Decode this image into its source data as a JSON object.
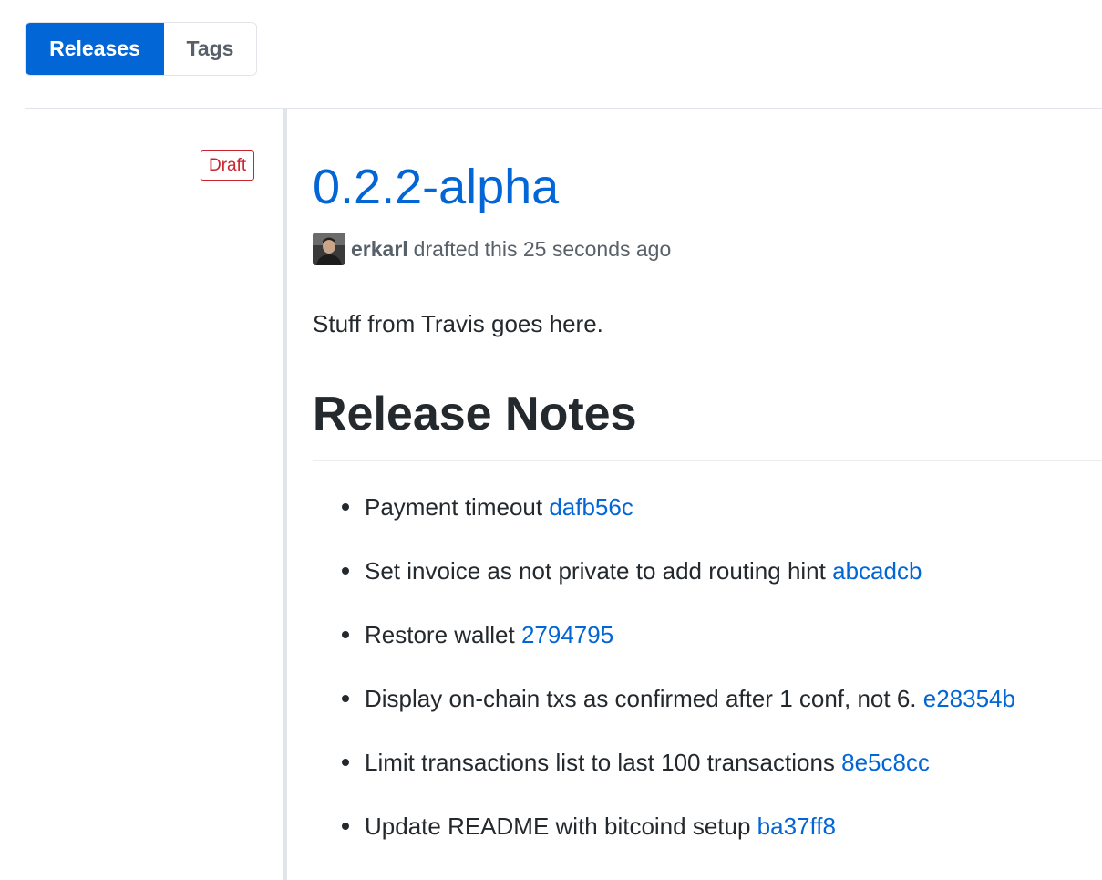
{
  "tabs": {
    "releases": "Releases",
    "tags": "Tags"
  },
  "release": {
    "status_label": "Draft",
    "title": "0.2.2-alpha",
    "author": "erkarl",
    "meta_text": "drafted this 25 seconds ago",
    "body": "Stuff from Travis goes here.",
    "notes_heading": "Release Notes",
    "notes": [
      {
        "text": "Payment timeout",
        "commit": "dafb56c"
      },
      {
        "text": "Set invoice as not private to add routing hint",
        "commit": "abcadcb"
      },
      {
        "text": "Restore wallet",
        "commit": "2794795"
      },
      {
        "text": "Display on-chain txs as confirmed after 1 conf, not 6.",
        "commit": "e28354b"
      },
      {
        "text": "Limit transactions list to last 100 transactions",
        "commit": "8e5c8cc"
      },
      {
        "text": "Update README with bitcoind setup",
        "commit": "ba37ff8"
      }
    ]
  },
  "colors": {
    "accent": "#0366d6",
    "draft": "#cb2431",
    "text": "#24292e",
    "muted": "#586069"
  },
  "icons": {
    "avatar": "user-avatar"
  }
}
